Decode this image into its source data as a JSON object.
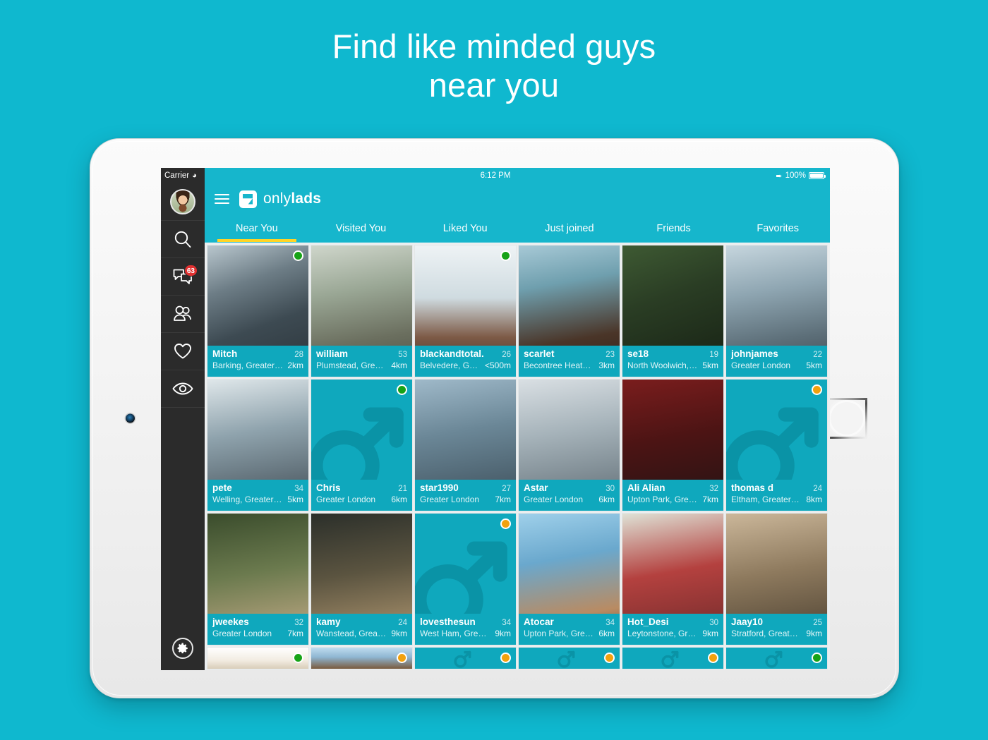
{
  "headline": {
    "line1": "Find like minded guys",
    "line2": "near you"
  },
  "colors": {
    "brand_teal": "#0fb8cf",
    "app_bar": "#16b6cc",
    "card_bg": "#0fa8bd",
    "tab_underline": "#ffd426",
    "online": "#17a317",
    "away": "#f2a10e",
    "badge": "#e03030"
  },
  "statusbar": {
    "carrier": "Carrier",
    "wifi_icon": "wifi-icon",
    "time": "6:12 PM",
    "location_icon": "location-arrow-icon",
    "battery_percent": "100%",
    "battery_icon": "battery-full-icon"
  },
  "rail": {
    "items": [
      {
        "name": "profile-avatar",
        "icon": "avatar-icon",
        "badge": null
      },
      {
        "name": "search",
        "icon": "search-icon",
        "badge": null
      },
      {
        "name": "messages",
        "icon": "chat-bubbles-icon",
        "badge": "63"
      },
      {
        "name": "friends",
        "icon": "people-icon",
        "badge": null
      },
      {
        "name": "favorites",
        "icon": "heart-icon",
        "badge": null
      },
      {
        "name": "viewed",
        "icon": "eye-icon",
        "badge": null
      }
    ],
    "settings_icon": "gear-icon"
  },
  "appbar": {
    "menu_icon": "hamburger-menu-icon",
    "logo_icon": "onlylads-logo-icon",
    "brand_light": "only",
    "brand_bold": "lads"
  },
  "tabs": [
    {
      "label": "Near You",
      "active": true
    },
    {
      "label": "Visited You",
      "active": false
    },
    {
      "label": "Liked You",
      "active": false
    },
    {
      "label": "Just joined",
      "active": false
    },
    {
      "label": "Friends",
      "active": false
    },
    {
      "label": "Favorites",
      "active": false
    }
  ],
  "profiles": [
    {
      "name": "Mitch",
      "age": "28",
      "location": "Barking, Greater…",
      "distance": "2km",
      "status": "online",
      "photo": "p1",
      "placeholder": false
    },
    {
      "name": "william",
      "age": "53",
      "location": "Plumstead, Grea…",
      "distance": "4km",
      "status": "none",
      "photo": "p2",
      "placeholder": false
    },
    {
      "name": "blackandtotal.",
      "age": "26",
      "location": "Belvedere, Gr…",
      "distance": "<500m",
      "status": "online",
      "photo": "p3",
      "placeholder": false
    },
    {
      "name": "scarlet",
      "age": "23",
      "location": "Becontree Heath…",
      "distance": "3km",
      "status": "none",
      "photo": "p4",
      "placeholder": false
    },
    {
      "name": "se18",
      "age": "19",
      "location": "North Woolwich,…",
      "distance": "5km",
      "status": "none",
      "photo": "p5",
      "placeholder": false
    },
    {
      "name": "johnjames",
      "age": "22",
      "location": "Greater London",
      "distance": "5km",
      "status": "none",
      "photo": "p6",
      "placeholder": false
    },
    {
      "name": "pete",
      "age": "34",
      "location": "Welling, Greater…",
      "distance": "5km",
      "status": "none",
      "photo": "p7",
      "placeholder": false
    },
    {
      "name": "Chris",
      "age": "21",
      "location": "Greater London",
      "distance": "6km",
      "status": "online",
      "photo": "",
      "placeholder": true
    },
    {
      "name": "star1990",
      "age": "27",
      "location": "Greater London",
      "distance": "7km",
      "status": "none",
      "photo": "p8",
      "placeholder": false
    },
    {
      "name": "Astar",
      "age": "30",
      "location": "Greater London",
      "distance": "6km",
      "status": "none",
      "photo": "p9",
      "placeholder": false
    },
    {
      "name": "Ali Alian",
      "age": "32",
      "location": "Upton Park, Gre…",
      "distance": "7km",
      "status": "none",
      "photo": "p10",
      "placeholder": false
    },
    {
      "name": "thomas d",
      "age": "24",
      "location": "Eltham, Greater…",
      "distance": "8km",
      "status": "away",
      "photo": "",
      "placeholder": true
    },
    {
      "name": "jweekes",
      "age": "32",
      "location": "Greater London",
      "distance": "7km",
      "status": "none",
      "photo": "p11",
      "placeholder": false
    },
    {
      "name": "kamy",
      "age": "24",
      "location": "Wanstead, Great…",
      "distance": "9km",
      "status": "none",
      "photo": "p12",
      "placeholder": false
    },
    {
      "name": "lovesthesun",
      "age": "34",
      "location": "West Ham, Great…",
      "distance": "9km",
      "status": "away",
      "photo": "",
      "placeholder": true
    },
    {
      "name": "Atocar",
      "age": "34",
      "location": "Upton Park, Gre…",
      "distance": "6km",
      "status": "none",
      "photo": "p13",
      "placeholder": false
    },
    {
      "name": "Hot_Desi",
      "age": "30",
      "location": "Leytonstone, Gr…",
      "distance": "9km",
      "status": "none",
      "photo": "p14",
      "placeholder": false
    },
    {
      "name": "Jaay10",
      "age": "25",
      "location": "Stratford, Greate…",
      "distance": "9km",
      "status": "none",
      "photo": "p15",
      "placeholder": false
    }
  ],
  "profiles_partial": [
    {
      "status": "online",
      "photo": "p16",
      "placeholder": false
    },
    {
      "status": "away",
      "photo": "p17",
      "placeholder": false
    },
    {
      "status": "away",
      "photo": "",
      "placeholder": true
    },
    {
      "status": "away",
      "photo": "",
      "placeholder": true
    },
    {
      "status": "away",
      "photo": "",
      "placeholder": true
    },
    {
      "status": "online",
      "photo": "",
      "placeholder": true
    }
  ]
}
